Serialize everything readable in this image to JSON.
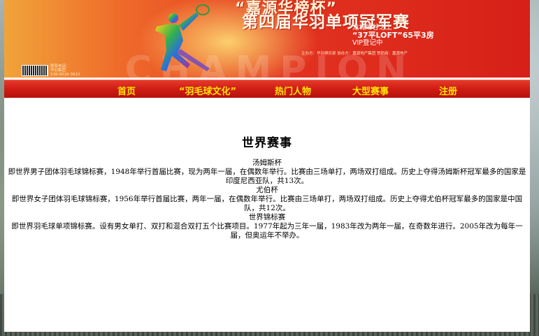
{
  "banner": {
    "title_line1": "“嘉源华榜杯”",
    "title_line2": "第四届华羽单项冠军赛",
    "promo_line1": "龙城峰谷之上",
    "promo_line2": "“37平LOFT”65平3房",
    "promo_line3": "VIP登记中",
    "watermark": "CHAMPION",
    "org_line": "主办方：华羽俱乐部 协办方：嘉源地产集团 赞助商：嘉源地产",
    "contact_line1": "联系电话：",
    "contact_line2": "华羽集团",
    "contact_line3": "136-0016-3622"
  },
  "nav": {
    "items": [
      {
        "label": "首页"
      },
      {
        "label": "“羽毛球文化”"
      },
      {
        "label": "热门人物"
      },
      {
        "label": "大型赛事"
      },
      {
        "label": "注册"
      }
    ]
  },
  "main": {
    "title": "世界赛事",
    "sections": [
      {
        "heading": "汤姆斯杯",
        "text": "即世界男子团体羽毛球锦标赛，1948年举行首届比赛，现为两年一届，在偶数年举行。比赛由三场单打，两场双打组成。历史上夺得汤姆斯杯冠军最多的国家是印度尼西亚队，共13次。"
      },
      {
        "heading": "尤伯杯",
        "text": "即世界女子团体羽毛球锦标赛，1956年举行首届比赛，两年一届，在偶数年举行。比赛由三场单打，两场双打组成。历史上夺得尤伯杯冠军最多的国家是中国队，共12次。"
      },
      {
        "heading": "世界锦标赛",
        "text": "即世界羽毛球单项锦标赛。设有男女单打、双打和混合双打五个比赛项目。1977年起为三年一届，1983年改为两年一届，在奇数年进行。2005年改为每年一届，但奥运年不举办。"
      }
    ]
  }
}
